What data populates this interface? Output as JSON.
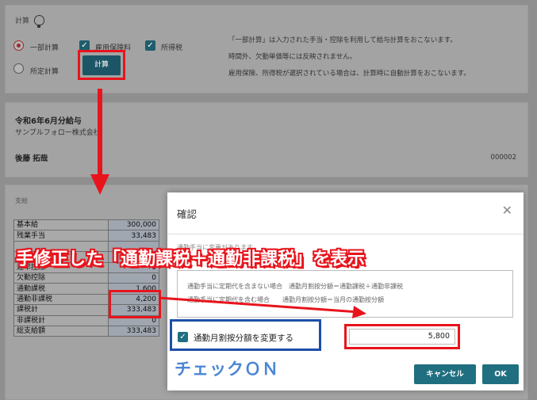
{
  "calc_section": {
    "title": "計算",
    "partial_calc_label": "一部計算",
    "employment_insurance_label": "雇用保険料",
    "income_tax_label": "所得税",
    "specified_calc_label": "所定計算",
    "calc_button": "計算",
    "notes": [
      "「一部計算」は入力された手当・控除を利用して給与計算をおこないます。",
      "時間外、欠勤単価等には反映されません。",
      "雇用保険、所得税が選択されている場合は、計算時に自動計算をおこないます。"
    ]
  },
  "payslip": {
    "title": "令和6年6月分給与",
    "company": "サンプルフォロー株式会社",
    "employee_name": "後藤 拓哉",
    "employee_no": "000002"
  },
  "detail": {
    "head": "支給",
    "rows": [
      {
        "label": "基本給",
        "value": "300,000"
      },
      {
        "label": "残業手当",
        "value": "33,483"
      },
      {
        "label": "",
        "value": ""
      },
      {
        "label": "",
        "value": ""
      },
      {
        "label": "遅早控除",
        "value": "0"
      },
      {
        "label": "欠勤控除",
        "value": "0"
      },
      {
        "label": "通勤課税",
        "value": "1,600"
      },
      {
        "label": "通勤非課税",
        "value": "4,200"
      },
      {
        "label": "課税計",
        "value": "333,483"
      },
      {
        "label": "非課税計",
        "value": "0"
      },
      {
        "label": "総支給額",
        "value": "333,483"
      }
    ]
  },
  "modal": {
    "title": "確認",
    "faded_text": "通勤手当に変更があります",
    "info_lines": [
      "通勤手当に定期代を含まない場合　通勤月割按分額＝通勤課税＋通勤非課税",
      "通勤手当に定期代を含む場合　　通勤月割按分額＝当月の通勤按分額"
    ],
    "checkbox_label": "通勤月割按分額を変更する",
    "amount_value": "5,800",
    "cancel_button": "キャンセル",
    "ok_button": "OK"
  },
  "annotations": {
    "banner": "手修正した「通勤課税＋通勤非課税」を表示",
    "check_caption": "チェックＯＮ"
  },
  "colors": {
    "accent_red": "#e8141c",
    "accent_blue": "#1d4fa8",
    "button_teal": "#1f6f80"
  }
}
